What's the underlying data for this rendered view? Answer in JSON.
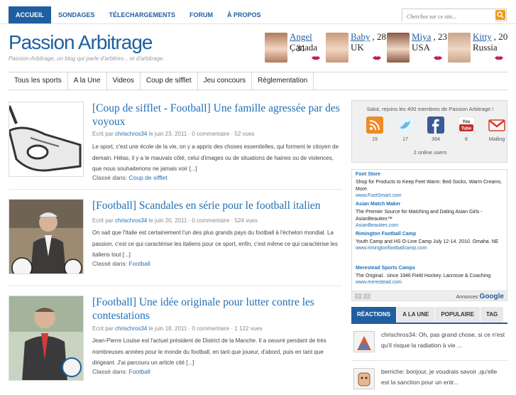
{
  "topnav": {
    "items": [
      "ACCUEIL",
      "SONDAGES",
      "TÉLECHARGEMENTS",
      "FORUM",
      "À PROPOS"
    ]
  },
  "search": {
    "placeholder": "Cherchez sur ce site..."
  },
  "site": {
    "title": "Passion Arbitrage",
    "tagline": "Passion-Arbitrage, un blog qui parle d'arbitres... et d'arbitrage."
  },
  "profiles": [
    {
      "name": "Angel",
      "age": ", 31",
      "country": "Canada",
      "photo_color": "#b07a5a"
    },
    {
      "name": "Baby",
      "age": ", 28",
      "country": "UK",
      "photo_color": "#c89a78"
    },
    {
      "name": "Miya",
      "age": ", 23",
      "country": "USA",
      "photo_color": "#8a5a44"
    },
    {
      "name": "Kitty",
      "age": ", 20",
      "country": "Russia",
      "photo_color": "#caa58a"
    }
  ],
  "mainnav": {
    "items": [
      "Tous les sports",
      "A la Une",
      "Videos",
      "Coup de sifflet",
      "Jeu concours",
      "Règlementation"
    ]
  },
  "posts": [
    {
      "title": "[Coup de sifflet - Football] Une famille agressée par des voyoux",
      "meta_prefix": "Ecrit par ",
      "author": "chrischros34",
      "meta_rest": " le juin 23, 2011 · 0 commentaire · 52 vues",
      "excerpt": "Le sport, c'est une école de la vie, on y a appris des choses essentielles, qui forment le citoyen de demain. Hélas, il y a le mauvais côté, celui d'images ou de situations de haines ou de violences, que nous souhaiterions ne jamais voir [...]",
      "cat_label": "Classé dans: ",
      "category": "Coup de sifflet"
    },
    {
      "title": "[Football] Scandales en série pour le football italien",
      "meta_prefix": "Ecrit par ",
      "author": "chrischros34",
      "meta_rest": " le juin 20, 2011 · 0 commentaire · 524 vues",
      "excerpt": "On sait que l'Italie est certainement l'un des plus grands pays du football à l'échelon mondial. La passion, c'est ce qui caractérise les italiens pour ce sport, enfin, c'est même ce qui caractérise les italiens tout [...]",
      "cat_label": "Classé dans: ",
      "category": "Football"
    },
    {
      "title": "[Football] Une idée originale pour lutter contre les contestations",
      "meta_prefix": "Ecrit par ",
      "author": "chrischros34",
      "meta_rest": " le juin 18, 2011 · 0 commentaire · 1 122 vues",
      "excerpt": "Jean-Pierre Louise est l'actuel président de District de la Manche. Il a oeuvré pendant de très nombreuses années pour le monde du football, en tant que joueur, d'abord, puis en tant que dirigeant. J'ai parcouru un article cité [...]",
      "cat_label": "Classé dans: ",
      "category": "Football"
    }
  ],
  "social": {
    "text": "Salut, rejoins les 400 membres de Passion Arbitrage !",
    "items": [
      {
        "icon": "rss-icon",
        "count": "19",
        "color": "#f08a24"
      },
      {
        "icon": "twitter-icon",
        "count": "17",
        "color": "#6fb7e8"
      },
      {
        "icon": "facebook-icon",
        "count": "394",
        "color": "#3b5998"
      },
      {
        "icon": "youtube-icon",
        "count": "6",
        "color": "#c4302b"
      },
      {
        "icon": "mail-icon",
        "count": "Mailing",
        "color": "#d93a2b"
      }
    ],
    "online": "2 online users"
  },
  "ads": {
    "items": [
      {
        "title": "Foot Store",
        "desc": "Shop for Products to Keep Feet Warm: Bed Socks. Warm Creams. More.",
        "url": "www.FootSmart.com"
      },
      {
        "title": "Asian Match Maker",
        "desc": "The Premier Source for Matching and Dating Asian Girls - AsianBeauties™",
        "url": "AsianBeauties.com"
      },
      {
        "title": "Rimington Football Camp",
        "desc": "Youth Camp and HS O-Line Camp July 12-14. 2010. Omaha. NE",
        "url": "www.rimingtonfootballcamp.com"
      },
      {
        "title": "Merestead Sports Camps",
        "desc": "The Original.. since 1946 Field Hockey. Lacrosse & Coaching",
        "url": "www.merestead.com"
      }
    ],
    "brand_label": "Annonces",
    "brand_name": "Google"
  },
  "tabs": {
    "items": [
      "RÉACTIONS",
      "A LA UNE",
      "POPULAIRE",
      "TAG"
    ]
  },
  "comments": [
    {
      "text": "chrischros34: Oh, pas grand chose, si ce n'est qu'il risque la radiation à vie ..."
    },
    {
      "text": "berriche: bonjour, je voudrais savoir ,qu'elle est la sanction pour un entr..."
    }
  ],
  "colors": {
    "accent": "#1f5fa0",
    "link": "#1f6fb5",
    "search_button": "#f29a1c"
  }
}
